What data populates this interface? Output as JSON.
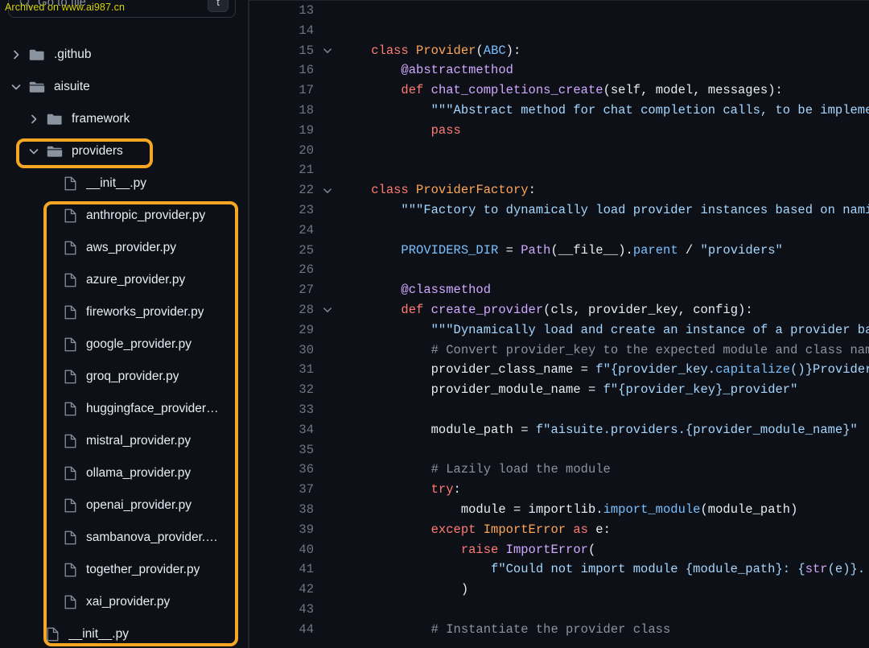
{
  "search": {
    "placeholder": "Go to file",
    "shortcut_key": "t",
    "icon": "search-icon"
  },
  "watermark": "Archived on www.ai987.cn",
  "colors": {
    "highlight": "#f5a623",
    "background": "#0d1117",
    "text": "#e6edf3",
    "muted": "#8b949e",
    "keyword": "#ff7b72",
    "class": "#ffa657",
    "function": "#d2a8ff",
    "builtin": "#79c0ff",
    "string": "#a5d6ff",
    "comment": "#8b949e",
    "linenum": "#6e7681"
  },
  "tree": [
    {
      "label": ".github",
      "type": "folder",
      "state": "collapsed",
      "depth": 0,
      "highlighted": false
    },
    {
      "label": "aisuite",
      "type": "folder",
      "state": "expanded",
      "depth": 0,
      "highlighted": false
    },
    {
      "label": "framework",
      "type": "folder",
      "state": "collapsed",
      "depth": 1,
      "highlighted": false
    },
    {
      "label": "providers",
      "type": "folder",
      "state": "expanded",
      "depth": 1,
      "highlighted": true
    },
    {
      "label": "__init__.py",
      "type": "file",
      "state": "",
      "depth": 2,
      "highlighted": false
    },
    {
      "label": "anthropic_provider.py",
      "type": "file",
      "state": "",
      "depth": 2,
      "highlighted": true
    },
    {
      "label": "aws_provider.py",
      "type": "file",
      "state": "",
      "depth": 2,
      "highlighted": true
    },
    {
      "label": "azure_provider.py",
      "type": "file",
      "state": "",
      "depth": 2,
      "highlighted": true
    },
    {
      "label": "fireworks_provider.py",
      "type": "file",
      "state": "",
      "depth": 2,
      "highlighted": true
    },
    {
      "label": "google_provider.py",
      "type": "file",
      "state": "",
      "depth": 2,
      "highlighted": true
    },
    {
      "label": "groq_provider.py",
      "type": "file",
      "state": "",
      "depth": 2,
      "highlighted": true
    },
    {
      "label": "huggingface_provider…",
      "type": "file",
      "state": "",
      "depth": 2,
      "highlighted": true
    },
    {
      "label": "mistral_provider.py",
      "type": "file",
      "state": "",
      "depth": 2,
      "highlighted": true
    },
    {
      "label": "ollama_provider.py",
      "type": "file",
      "state": "",
      "depth": 2,
      "highlighted": true
    },
    {
      "label": "openai_provider.py",
      "type": "file",
      "state": "",
      "depth": 2,
      "highlighted": true
    },
    {
      "label": "sambanova_provider.…",
      "type": "file",
      "state": "",
      "depth": 2,
      "highlighted": true
    },
    {
      "label": "together_provider.py",
      "type": "file",
      "state": "",
      "depth": 2,
      "highlighted": true
    },
    {
      "label": "xai_provider.py",
      "type": "file",
      "state": "",
      "depth": 2,
      "highlighted": true
    },
    {
      "label": "__init__.py",
      "type": "file",
      "state": "",
      "depth": 1,
      "highlighted": false
    }
  ],
  "editor": {
    "first_line": 13,
    "lines": [
      {
        "n": 13,
        "fold": "",
        "tokens": []
      },
      {
        "n": 14,
        "fold": "",
        "tokens": []
      },
      {
        "n": 15,
        "fold": "down",
        "tokens": [
          {
            "t": "    ",
            "c": "t-punc"
          },
          {
            "t": "class ",
            "c": "t-kw"
          },
          {
            "t": "Provider",
            "c": "t-cls"
          },
          {
            "t": "(",
            "c": "t-punc"
          },
          {
            "t": "ABC",
            "c": "t-builtin"
          },
          {
            "t": "):",
            "c": "t-punc"
          }
        ]
      },
      {
        "n": 16,
        "fold": "",
        "tokens": [
          {
            "t": "        ",
            "c": "t-punc"
          },
          {
            "t": "@abstractmethod",
            "c": "t-dec"
          }
        ]
      },
      {
        "n": 17,
        "fold": "",
        "tokens": [
          {
            "t": "        ",
            "c": "t-punc"
          },
          {
            "t": "def ",
            "c": "t-kw"
          },
          {
            "t": "chat_completions_create",
            "c": "t-fn"
          },
          {
            "t": "(self, model, messages):",
            "c": "t-punc"
          }
        ]
      },
      {
        "n": 18,
        "fold": "",
        "tokens": [
          {
            "t": "            ",
            "c": "t-punc"
          },
          {
            "t": "\"\"\"Abstract method for chat completion calls, to be implemented",
            "c": "t-str"
          }
        ]
      },
      {
        "n": 19,
        "fold": "",
        "tokens": [
          {
            "t": "            ",
            "c": "t-punc"
          },
          {
            "t": "pass",
            "c": "t-kw"
          }
        ]
      },
      {
        "n": 20,
        "fold": "",
        "tokens": []
      },
      {
        "n": 21,
        "fold": "",
        "tokens": []
      },
      {
        "n": 22,
        "fold": "down",
        "tokens": [
          {
            "t": "    ",
            "c": "t-punc"
          },
          {
            "t": "class ",
            "c": "t-kw"
          },
          {
            "t": "ProviderFactory",
            "c": "t-cls"
          },
          {
            "t": ":",
            "c": "t-punc"
          }
        ]
      },
      {
        "n": 23,
        "fold": "",
        "tokens": [
          {
            "t": "        ",
            "c": "t-punc"
          },
          {
            "t": "\"\"\"Factory to dynamically load provider instances based on naming c",
            "c": "t-str"
          }
        ]
      },
      {
        "n": 24,
        "fold": "",
        "tokens": []
      },
      {
        "n": 25,
        "fold": "",
        "tokens": [
          {
            "t": "        ",
            "c": "t-punc"
          },
          {
            "t": "PROVIDERS_DIR",
            "c": "t-builtin"
          },
          {
            "t": " = ",
            "c": "t-punc"
          },
          {
            "t": "Path",
            "c": "t-fn"
          },
          {
            "t": "(",
            "c": "t-punc"
          },
          {
            "t": "__file__",
            "c": "t-punc"
          },
          {
            "t": ").",
            "c": "t-punc"
          },
          {
            "t": "parent",
            "c": "t-builtin"
          },
          {
            "t": " / ",
            "c": "t-punc"
          },
          {
            "t": "\"providers\"",
            "c": "t-str"
          }
        ]
      },
      {
        "n": 26,
        "fold": "",
        "tokens": []
      },
      {
        "n": 27,
        "fold": "",
        "tokens": [
          {
            "t": "        ",
            "c": "t-punc"
          },
          {
            "t": "@classmethod",
            "c": "t-dec"
          }
        ]
      },
      {
        "n": 28,
        "fold": "down",
        "tokens": [
          {
            "t": "        ",
            "c": "t-punc"
          },
          {
            "t": "def ",
            "c": "t-kw"
          },
          {
            "t": "create_provider",
            "c": "t-fn"
          },
          {
            "t": "(cls, provider_key, config):",
            "c": "t-punc"
          }
        ]
      },
      {
        "n": 29,
        "fold": "",
        "tokens": [
          {
            "t": "            ",
            "c": "t-punc"
          },
          {
            "t": "\"\"\"Dynamically load and create an instance of a provider based",
            "c": "t-str"
          }
        ]
      },
      {
        "n": 30,
        "fold": "",
        "tokens": [
          {
            "t": "            ",
            "c": "t-punc"
          },
          {
            "t": "# Convert provider_key to the expected module and class names",
            "c": "t-cmt"
          }
        ]
      },
      {
        "n": 31,
        "fold": "",
        "tokens": [
          {
            "t": "            ",
            "c": "t-punc"
          },
          {
            "t": "provider_class_name",
            "c": "t-punc"
          },
          {
            "t": " = ",
            "c": "t-punc"
          },
          {
            "t": "f\"{provider_key.",
            "c": "t-str"
          },
          {
            "t": "capitalize",
            "c": "t-builtin"
          },
          {
            "t": "()}Provider\"",
            "c": "t-str"
          }
        ]
      },
      {
        "n": 32,
        "fold": "",
        "tokens": [
          {
            "t": "            ",
            "c": "t-punc"
          },
          {
            "t": "provider_module_name",
            "c": "t-punc"
          },
          {
            "t": " = ",
            "c": "t-punc"
          },
          {
            "t": "f\"{provider_key}_provider\"",
            "c": "t-str"
          }
        ]
      },
      {
        "n": 33,
        "fold": "",
        "tokens": []
      },
      {
        "n": 34,
        "fold": "",
        "tokens": [
          {
            "t": "            ",
            "c": "t-punc"
          },
          {
            "t": "module_path",
            "c": "t-punc"
          },
          {
            "t": " = ",
            "c": "t-punc"
          },
          {
            "t": "f\"aisuite.providers.{provider_module_name}\"",
            "c": "t-str"
          }
        ]
      },
      {
        "n": 35,
        "fold": "",
        "tokens": []
      },
      {
        "n": 36,
        "fold": "",
        "tokens": [
          {
            "t": "            ",
            "c": "t-punc"
          },
          {
            "t": "# Lazily load the module",
            "c": "t-cmt"
          }
        ]
      },
      {
        "n": 37,
        "fold": "",
        "tokens": [
          {
            "t": "            ",
            "c": "t-punc"
          },
          {
            "t": "try",
            "c": "t-kw"
          },
          {
            "t": ":",
            "c": "t-punc"
          }
        ]
      },
      {
        "n": 38,
        "fold": "",
        "tokens": [
          {
            "t": "                ",
            "c": "t-punc"
          },
          {
            "t": "module",
            "c": "t-punc"
          },
          {
            "t": " = ",
            "c": "t-punc"
          },
          {
            "t": "importlib.",
            "c": "t-punc"
          },
          {
            "t": "import_module",
            "c": "t-builtin"
          },
          {
            "t": "(module_path)",
            "c": "t-punc"
          }
        ]
      },
      {
        "n": 39,
        "fold": "",
        "tokens": [
          {
            "t": "            ",
            "c": "t-punc"
          },
          {
            "t": "except ",
            "c": "t-kw"
          },
          {
            "t": "ImportError",
            "c": "t-cls"
          },
          {
            "t": " as ",
            "c": "t-kw"
          },
          {
            "t": "e:",
            "c": "t-punc"
          }
        ]
      },
      {
        "n": 40,
        "fold": "",
        "tokens": [
          {
            "t": "                ",
            "c": "t-punc"
          },
          {
            "t": "raise ",
            "c": "t-kw"
          },
          {
            "t": "ImportError",
            "c": "t-fn"
          },
          {
            "t": "(",
            "c": "t-punc"
          }
        ]
      },
      {
        "n": 41,
        "fold": "",
        "tokens": [
          {
            "t": "                    ",
            "c": "t-punc"
          },
          {
            "t": "f\"Could not import module {module_path}: {",
            "c": "t-str"
          },
          {
            "t": "str",
            "c": "t-fn"
          },
          {
            "t": "(e)}. Plea",
            "c": "t-str"
          }
        ]
      },
      {
        "n": 42,
        "fold": "",
        "tokens": [
          {
            "t": "                ",
            "c": "t-punc"
          },
          {
            "t": ")",
            "c": "t-punc"
          }
        ]
      },
      {
        "n": 43,
        "fold": "",
        "tokens": []
      },
      {
        "n": 44,
        "fold": "",
        "tokens": [
          {
            "t": "            ",
            "c": "t-punc"
          },
          {
            "t": "# Instantiate the provider class",
            "c": "t-cmt"
          }
        ]
      }
    ]
  }
}
